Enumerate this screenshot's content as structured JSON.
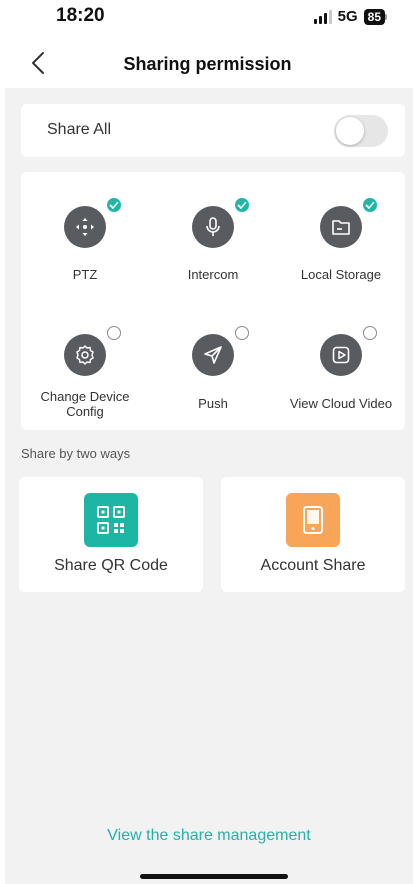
{
  "status_bar": {
    "time": "18:20",
    "network": "5G",
    "battery": "85"
  },
  "nav": {
    "title": "Sharing permission"
  },
  "share_all": {
    "label": "Share All",
    "enabled": false
  },
  "permissions": [
    {
      "label": "PTZ",
      "checked": true,
      "icon": "ptz-icon"
    },
    {
      "label": "Intercom",
      "checked": true,
      "icon": "microphone-icon"
    },
    {
      "label": "Local Storage",
      "checked": true,
      "icon": "folder-icon"
    },
    {
      "label": "Change Device Config",
      "checked": false,
      "icon": "gear-icon"
    },
    {
      "label": "Push",
      "checked": false,
      "icon": "send-icon"
    },
    {
      "label": "View Cloud Video",
      "checked": false,
      "icon": "play-icon"
    }
  ],
  "share_ways": {
    "section_label": "Share by two ways",
    "qr": {
      "label": "Share QR Code",
      "icon": "qr-code-icon",
      "color": "#1db5a3"
    },
    "account": {
      "label": "Account Share",
      "icon": "tablet-icon",
      "color": "#f8a55a"
    }
  },
  "footer": {
    "manage_link": "View the share management"
  },
  "colors": {
    "accent": "#27b0a6",
    "check_on": "#1fb8a6",
    "icon_bg": "#585c60",
    "page_bg": "#f2f2f2"
  }
}
